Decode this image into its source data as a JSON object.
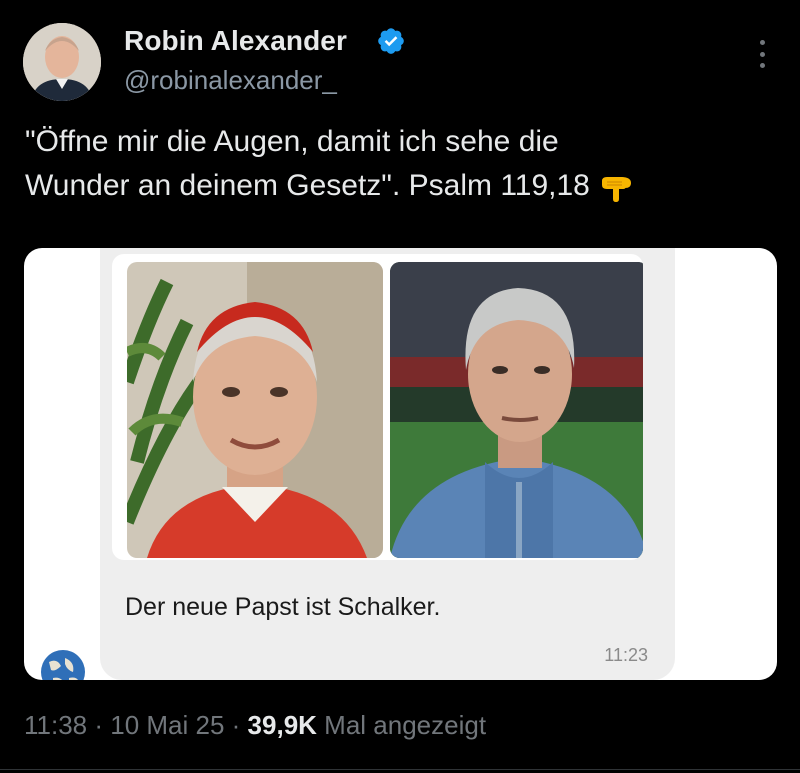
{
  "author": {
    "name": "Robin Alexander",
    "handle": "@robinalexander_",
    "verified": true,
    "avatar_icon": "profile-photo"
  },
  "tweet": {
    "line1": "\"Öffne mir die Augen, damit ich sehe die",
    "line2": "Wunder an deinem Gesetz\". Psalm 119,18",
    "emoji": "backhand-index-pointing-down"
  },
  "embedded_message": {
    "caption": "Der neue Papst ist Schalker.",
    "time": "11:23",
    "images": [
      "cardinal-portrait",
      "football-coach-portrait"
    ]
  },
  "meta": {
    "time": "11:38",
    "sep1": " · ",
    "date": "10 Mai 25",
    "sep2": " · ",
    "views": "39,9K",
    "views_label": " Mal angezeigt"
  },
  "colors": {
    "background": "#000000",
    "verified_blue": "#1d9bf0",
    "secondary_text": "#71767b"
  }
}
